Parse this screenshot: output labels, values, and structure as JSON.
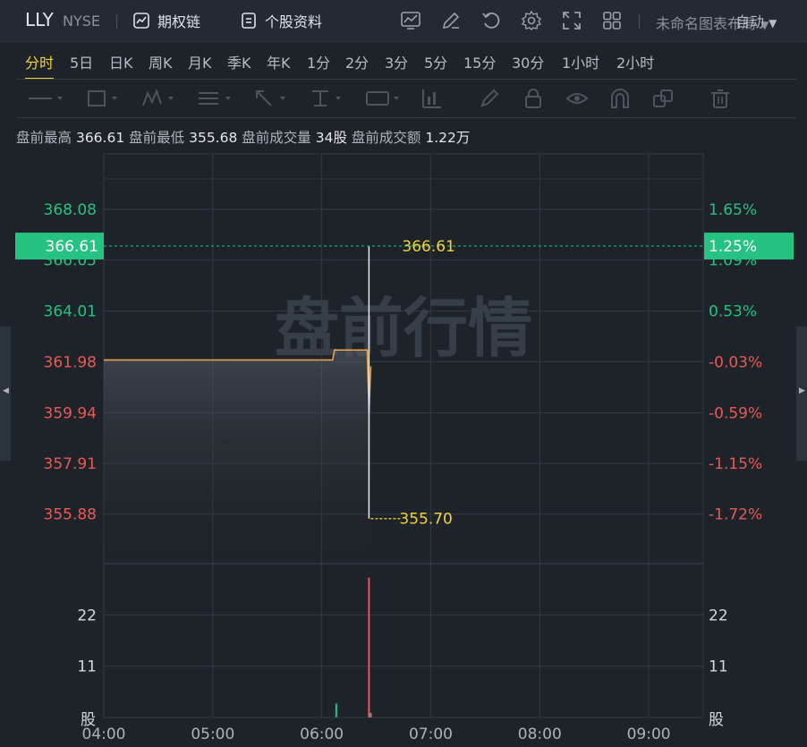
{
  "header": {
    "ticker": "LLY",
    "exchange": "NYSE",
    "options_chain": "期权链",
    "stock_profile": "个股资料",
    "layout_name": "未命名图表布局"
  },
  "periods": [
    "分时",
    "5日",
    "日K",
    "周K",
    "月K",
    "季K",
    "年K",
    "1分",
    "2分",
    "3分",
    "5分",
    "15分",
    "30分",
    "1小时",
    "2小时"
  ],
  "active_period": "分时",
  "auto_label": "自动",
  "stats": {
    "high_label": "盘前最高",
    "high_value": "366.61",
    "low_label": "盘前最低",
    "low_value": "355.68",
    "volume_label": "盘前成交量",
    "volume_value": "34股",
    "turnover_label": "盘前成交额",
    "turnover_value": "1.22万"
  },
  "colors": {
    "up": "#26c281",
    "down": "#e85a5a",
    "price_line": "#f0a64a",
    "marker": "#f2d43a",
    "badge": "#26c281"
  },
  "chart_data": {
    "type": "line",
    "watermark": "盘前行情",
    "x_ticks": [
      "04:00",
      "05:00",
      "06:00",
      "07:00",
      "08:00",
      "09:00"
    ],
    "y_ticks": [
      {
        "value": 368.08,
        "label": "368.08",
        "pct": "1.65%"
      },
      {
        "value": 366.05,
        "label": "366.05",
        "pct": "1.09%"
      },
      {
        "value": 364.01,
        "label": "364.01",
        "pct": "0.53%"
      },
      {
        "value": 361.98,
        "label": "361.98",
        "pct": "-0.03%"
      },
      {
        "value": 359.94,
        "label": "359.94",
        "pct": "-0.59%"
      },
      {
        "value": 357.91,
        "label": "357.91",
        "pct": "-1.15%"
      },
      {
        "value": 355.88,
        "label": "355.88",
        "pct": "-1.72%"
      }
    ],
    "ylim": [
      353.9,
      370.3
    ],
    "xlim_minutes": [
      240,
      570
    ],
    "prev_close_ref": 362.08,
    "series": [
      {
        "x": [
          "04:00",
          "06:06",
          "06:07",
          "06:25",
          "06:26",
          "06:27"
        ],
        "y": [
          362.05,
          362.05,
          362.45,
          362.45,
          359.94,
          361.8
        ]
      }
    ],
    "current": {
      "price": "366.61",
      "pct": "1.25%"
    },
    "spike": {
      "time": "06:25",
      "high": 366.61,
      "low": 355.7,
      "high_label": "366.61",
      "low_label": "355.70"
    },
    "volume": {
      "ticks": [
        {
          "value": 22,
          "label": "22"
        },
        {
          "value": 11,
          "label": "11"
        }
      ],
      "unit": "股",
      "ymax": 33,
      "bars": [
        {
          "time": "06:07",
          "value": 3,
          "dir": "up"
        },
        {
          "time": "06:25",
          "value": 30,
          "dir": "down"
        },
        {
          "time": "06:26",
          "value": 1,
          "dir": "flat"
        }
      ]
    }
  }
}
